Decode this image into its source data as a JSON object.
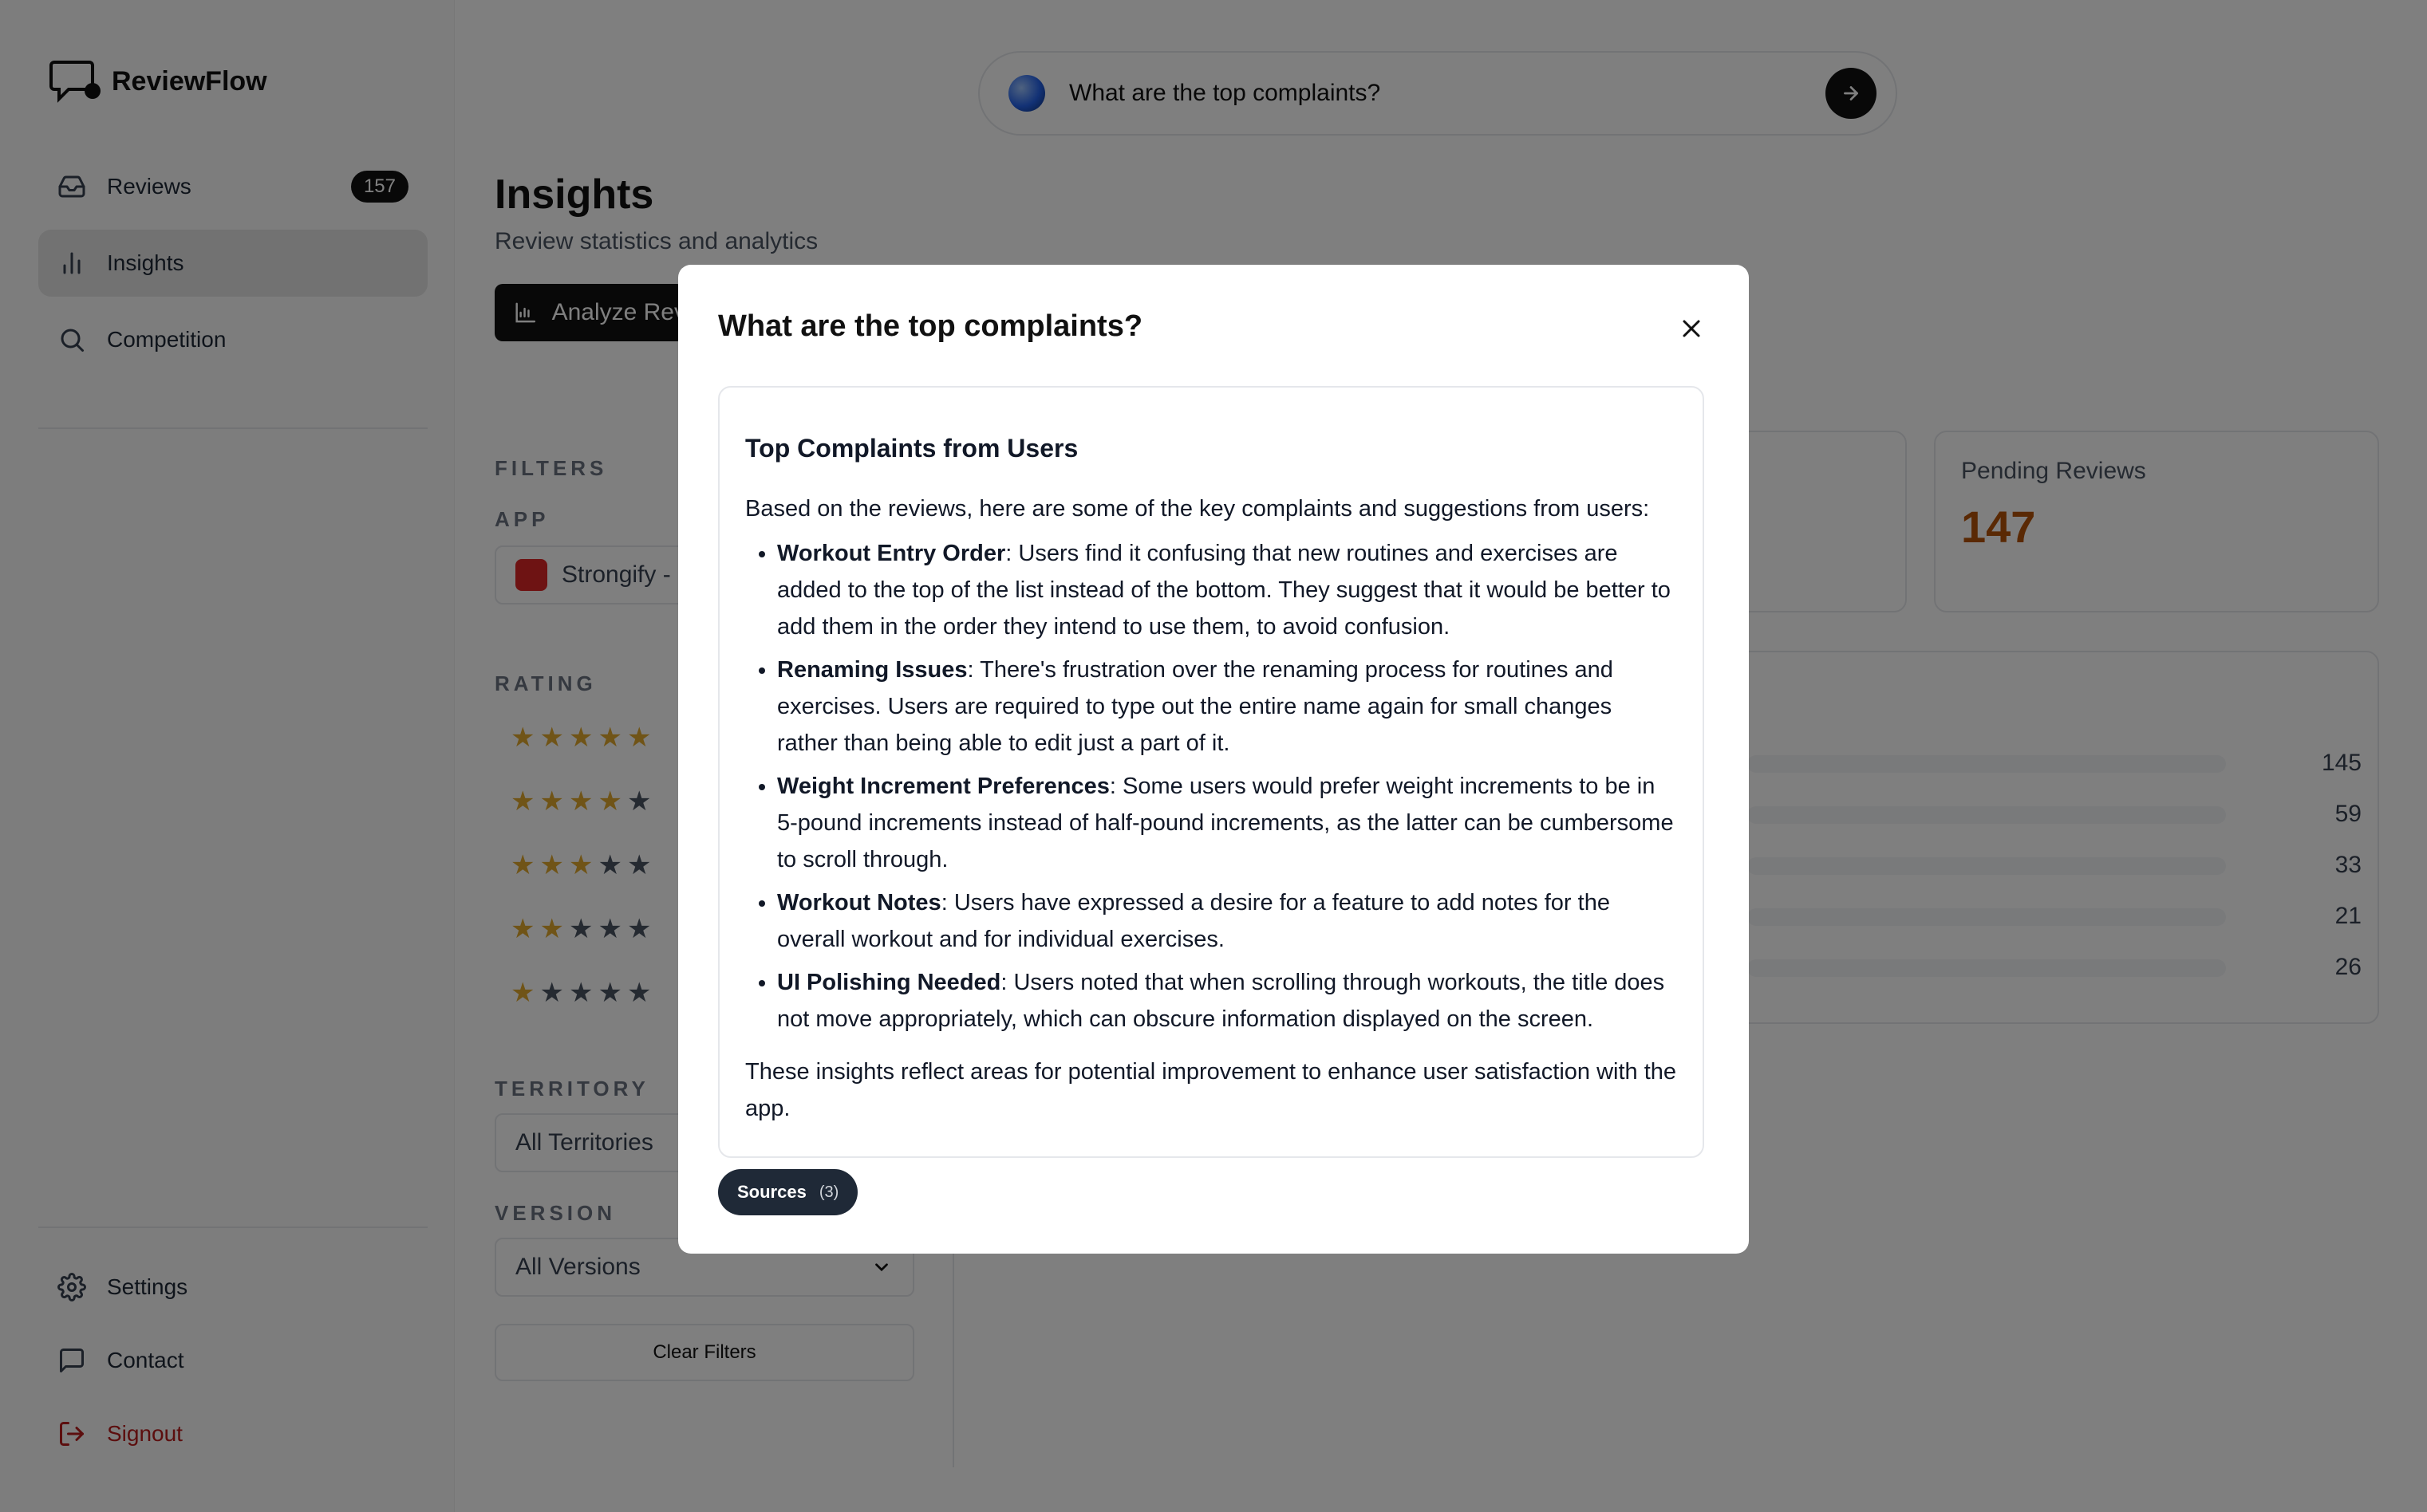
{
  "app": {
    "name": "ReviewFlow"
  },
  "sidebar": {
    "items": [
      {
        "label": "Reviews",
        "badge": "157",
        "icon": "inbox-icon"
      },
      {
        "label": "Insights",
        "icon": "bar-chart-icon"
      },
      {
        "label": "Competition",
        "icon": "search-icon"
      }
    ],
    "footer": [
      {
        "label": "Settings",
        "icon": "gear-icon"
      },
      {
        "label": "Contact",
        "icon": "message-icon"
      },
      {
        "label": "Signout",
        "icon": "signout-icon"
      }
    ]
  },
  "search": {
    "query": "What are the top complaints?"
  },
  "header": {
    "title": "Insights",
    "subtitle": "Review statistics and analytics",
    "analyze_label": "Analyze Reviews"
  },
  "filters": {
    "title": "FILTERS",
    "app_label": "APP",
    "app_value": "Strongify - ",
    "rating_label": "RATING",
    "ratings": [
      5,
      4,
      3,
      2,
      1
    ],
    "territory_label": "TERRITORY",
    "territory_value": "All Territories",
    "version_label": "VERSION",
    "version_value": "All Versions",
    "clear_label": "Clear Filters"
  },
  "stats": {
    "pending_label": "Pending Reviews",
    "pending_value": "147",
    "rating_counts": [
      "145",
      "59",
      "33",
      "21",
      "26"
    ]
  },
  "modal": {
    "title": "What are the top complaints?",
    "heading": "Top Complaints from Users",
    "intro": "Based on the reviews, here are some of the key complaints and suggestions from users:",
    "items": [
      {
        "title": "Workout Entry Order",
        "text": ": Users find it confusing that new routines and exercises are added to the top of the list instead of the bottom. They suggest that it would be better to add them in the order they intend to use them, to avoid confusion."
      },
      {
        "title": "Renaming Issues",
        "text": ": There's frustration over the renaming process for routines and exercises. Users are required to type out the entire name again for small changes rather than being able to edit just a part of it."
      },
      {
        "title": "Weight Increment Preferences",
        "text": ": Some users would prefer weight increments to be in 5-pound increments instead of half-pound increments, as the latter can be cumbersome to scroll through."
      },
      {
        "title": "Workout Notes",
        "text": ": Users have expressed a desire for a feature to add notes for the overall workout and for individual exercises."
      },
      {
        "title": "UI Polishing Needed",
        "text": ": Users noted that when scrolling through workouts, the title does not move appropriately, which can obscure information displayed on the screen."
      }
    ],
    "conclusion": "These insights reflect areas for potential improvement to enhance user satisfaction with the app.",
    "sources_label": "Sources",
    "sources_count": "(3)"
  }
}
